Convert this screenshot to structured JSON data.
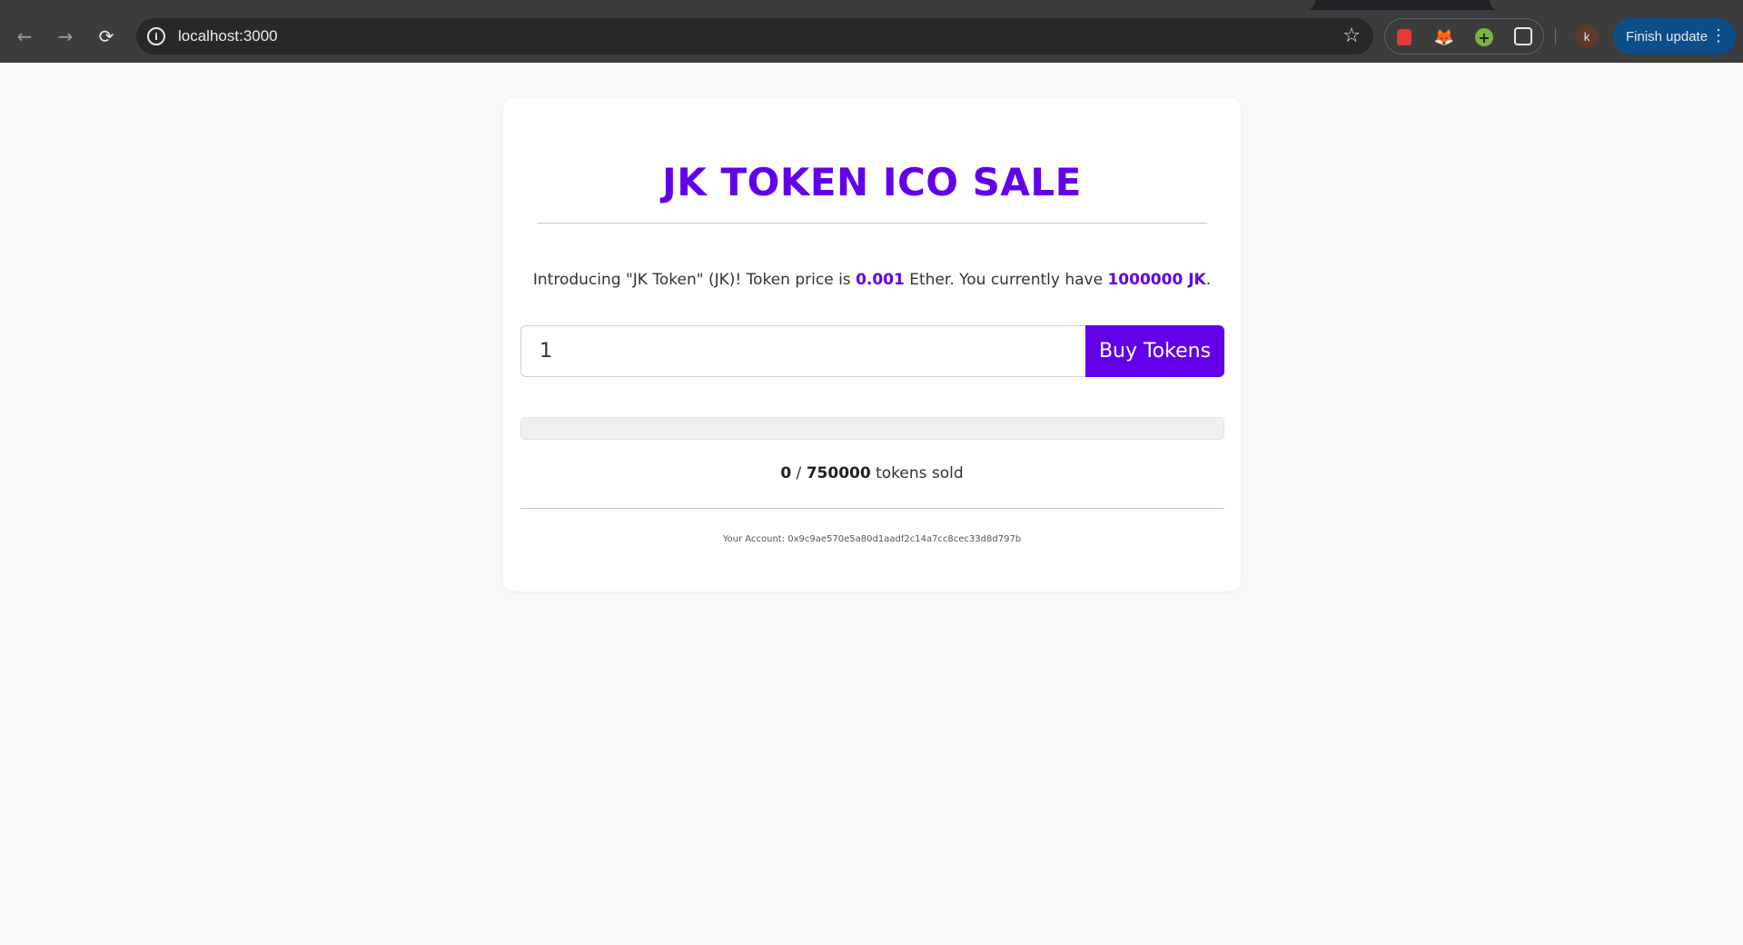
{
  "browser": {
    "url": "localhost:3000",
    "avatar_initial": "k",
    "finish_update_label": "Finish update"
  },
  "sale": {
    "title": "JK TOKEN ICO SALE",
    "intro_prefix": "Introducing \"JK Token\" (JK)! Token price is ",
    "token_price": "0.001",
    "intro_middle": " Ether. You currently have ",
    "balance": "1000000 JK",
    "intro_suffix": ".",
    "quantity_value": "1",
    "buy_button_label": "Buy Tokens",
    "tokens_sold": "0",
    "sold_separator": " / ",
    "tokens_available": "750000",
    "sold_suffix": " tokens sold",
    "progress_fraction": 0,
    "account_label": "Your Account: ",
    "account_address": "0x9c9ae570e5a80d1aadf2c14a7cc8cec33d8d797b"
  },
  "colors": {
    "accent": "#6200ea"
  }
}
